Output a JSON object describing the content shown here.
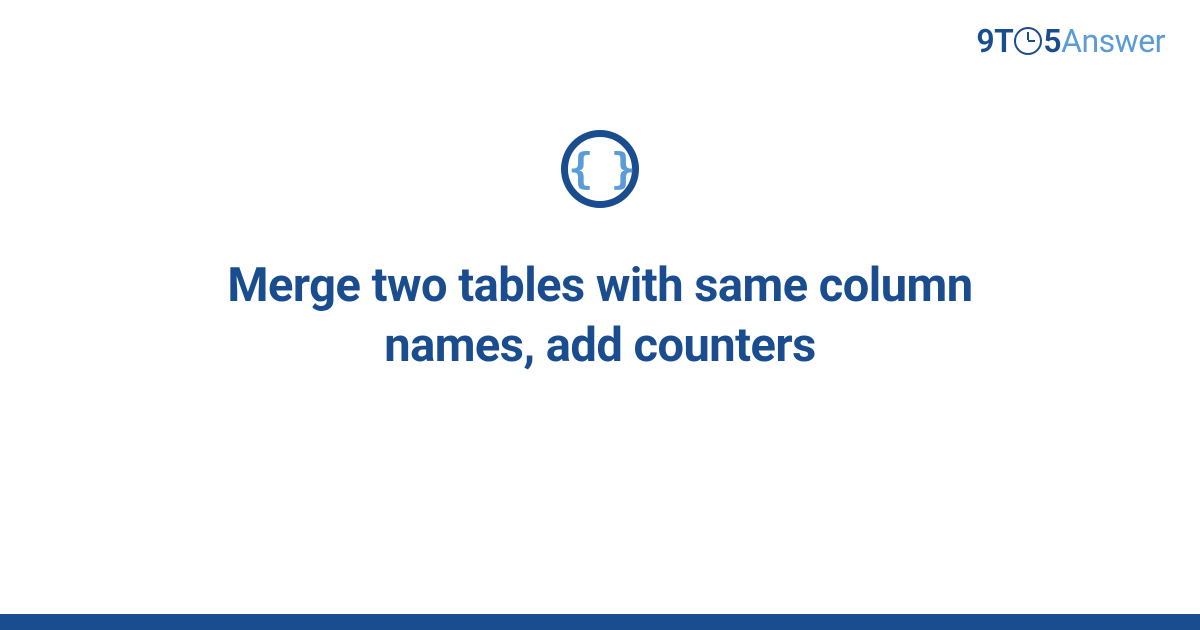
{
  "logo": {
    "prefix": "9T",
    "suffix": "5",
    "word": "Answer"
  },
  "icon": {
    "braces": "{ }"
  },
  "title": "Merge two tables with same column names, add counters",
  "colors": {
    "primary": "#1a4d8f",
    "accent": "#5a9bd8",
    "background": "#ffffff"
  }
}
